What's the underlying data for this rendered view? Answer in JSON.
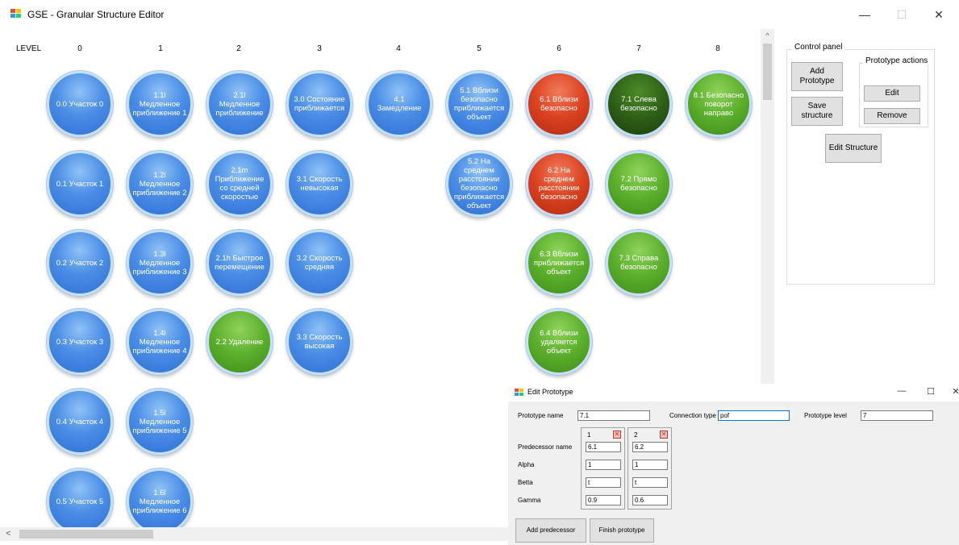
{
  "window": {
    "title": "GSE - Granular Structure Editor",
    "controls": {
      "minimize": "—",
      "maximize": "☐",
      "close": "✕"
    }
  },
  "levels": {
    "label": "LEVEL",
    "numbers": [
      "0",
      "1",
      "2",
      "3",
      "4",
      "5",
      "6",
      "7",
      "8"
    ]
  },
  "nodes": [
    {
      "label": "0.0 Участок 0",
      "color": "blue"
    },
    {
      "label": "0.1 Участок 1",
      "color": "blue"
    },
    {
      "label": "0.2 Участок 2",
      "color": "blue"
    },
    {
      "label": "0.3 Участок 3",
      "color": "blue"
    },
    {
      "label": "0.4 Участок 4",
      "color": "blue"
    },
    {
      "label": "0.5 Участок 5",
      "color": "blue"
    },
    {
      "label": "1.1l Медленное приближение 1",
      "color": "blue"
    },
    {
      "label": "1.2l Медленное приближение 2",
      "color": "blue"
    },
    {
      "label": "1.3l Медленное приближение 3",
      "color": "blue"
    },
    {
      "label": "1.4l Медленное приближение 4",
      "color": "blue"
    },
    {
      "label": "1.5l Медленное приближение 5",
      "color": "blue"
    },
    {
      "label": "1.6l Медленное приближение 6",
      "color": "blue"
    },
    {
      "label": "2.1l Медленное приближение",
      "color": "blue"
    },
    {
      "label": "2.1m Приближение со средней скоростью",
      "color": "blue"
    },
    {
      "label": "2.1h Быстрое перемещение",
      "color": "blue"
    },
    {
      "label": "2.2 Удаление",
      "color": "green"
    },
    {
      "label": "3.0 Состояние приближается",
      "color": "blue"
    },
    {
      "label": "3.1 Скорость невысокая",
      "color": "blue"
    },
    {
      "label": "3.2 Скорость средняя",
      "color": "blue"
    },
    {
      "label": "3.3 Скорость высокая",
      "color": "blue"
    },
    {
      "label": "4.1 Замедление",
      "color": "blue"
    },
    {
      "label": "5.1 Вблизи безопасно приближается объект",
      "color": "blue"
    },
    {
      "label": "5.2 На среднем расстоянии безопасно приближается объект",
      "color": "blue"
    },
    {
      "label": "6.1 Вблизи безопасно",
      "color": "red"
    },
    {
      "label": "6.2 На среднем расстоянии безопасно",
      "color": "red"
    },
    {
      "label": "6.3 Вблизи приближается объект",
      "color": "green"
    },
    {
      "label": "6.4 Вблизи удаляется объект",
      "color": "green"
    },
    {
      "label": "7.1 Слева безопасно",
      "color": "darkgreen"
    },
    {
      "label": "7.2 Прямо безопасно",
      "color": "green"
    },
    {
      "label": "7.3 Справа безопасно",
      "color": "green"
    },
    {
      "label": "8.1 Безопасно поворот направо",
      "color": "green"
    }
  ],
  "control_panel": {
    "title": "Control panel",
    "add_prototype": "Add Prototype",
    "save_structure": "Save structure",
    "edit_structure": "Edit Structure",
    "prototype_actions": {
      "title": "Prototype actions",
      "edit": "Edit",
      "remove": "Remove"
    }
  },
  "edit_dialog": {
    "title": "Edit Prototype",
    "controls": {
      "minimize": "—",
      "maximize": "☐",
      "close": "✕"
    },
    "prototype_name_label": "Prototype name",
    "prototype_name": "7.1",
    "connection_type_label": "Connection type",
    "connection_type": "pof",
    "prototype_level_label": "Prototype level",
    "prototype_level": "7",
    "predecessor_name_label": "Predecessor name",
    "alpha_label": "Alpha",
    "betta_label": "Betta",
    "gamma_label": "Gamma",
    "delete_icon": "✕",
    "predecessors": [
      {
        "number": "1",
        "name": "6.1",
        "alpha": "1",
        "betta": "t",
        "gamma": "0.9"
      },
      {
        "number": "2",
        "name": "6.2",
        "alpha": "1",
        "betta": "t",
        "gamma": "0.6"
      }
    ],
    "add_predecessor": "Add predecessor",
    "finish_prototype": "Finish prototype"
  },
  "scrollbars": {
    "up_arrow": "^",
    "left_arrow": "<"
  },
  "colors": {
    "blue": "#3f82e0",
    "red": "#d9411f",
    "green": "#5aae2b",
    "darkgreen": "#2c5c16",
    "focus_border": "#0078d7"
  }
}
